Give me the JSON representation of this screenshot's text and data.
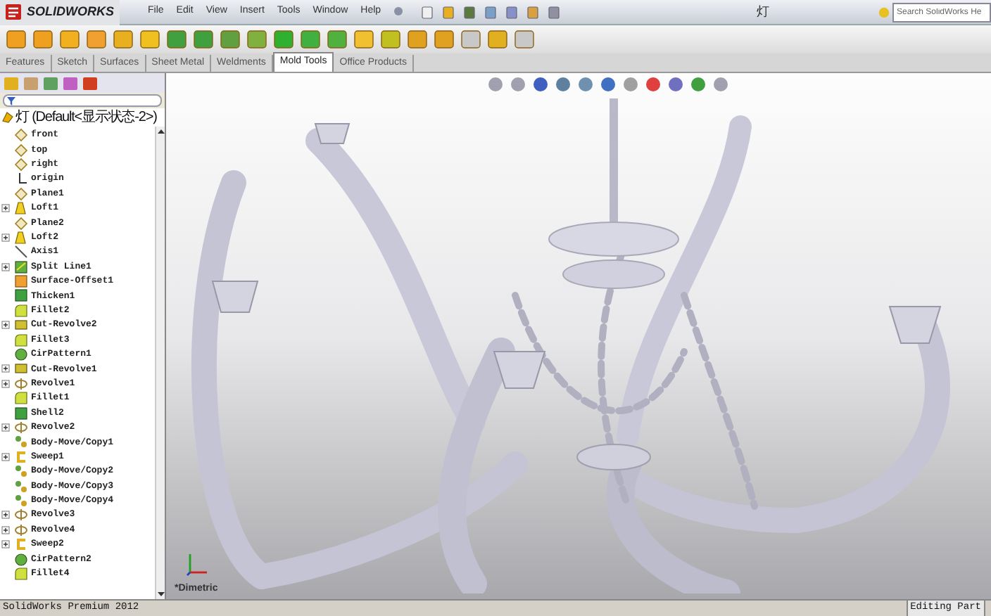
{
  "window": {
    "app_name": "SOLIDWORKS",
    "title": "灯"
  },
  "menu": [
    "File",
    "Edit",
    "View",
    "Insert",
    "Tools",
    "Window",
    "Help"
  ],
  "search": {
    "placeholder": "Search SolidWorks He"
  },
  "tabs": [
    {
      "label": "Features",
      "selected": false
    },
    {
      "label": "Sketch",
      "selected": false
    },
    {
      "label": "Surfaces",
      "selected": false
    },
    {
      "label": "Sheet Metal",
      "selected": false
    },
    {
      "label": "Weldments",
      "selected": false
    },
    {
      "label": "Mold Tools",
      "selected": true
    },
    {
      "label": "Office Products",
      "selected": false
    }
  ],
  "feature_tree": {
    "root": "灯 (Default<显示状态-2>)",
    "items": [
      {
        "label": "front",
        "kind": "plane",
        "expandable": false
      },
      {
        "label": "top",
        "kind": "plane",
        "expandable": false
      },
      {
        "label": "right",
        "kind": "plane",
        "expandable": false
      },
      {
        "label": "origin",
        "kind": "origin",
        "expandable": false
      },
      {
        "label": "Plane1",
        "kind": "plane",
        "expandable": false
      },
      {
        "label": "Loft1",
        "kind": "loft",
        "expandable": true
      },
      {
        "label": "Plane2",
        "kind": "plane",
        "expandable": false
      },
      {
        "label": "Loft2",
        "kind": "loft",
        "expandable": true
      },
      {
        "label": "Axis1",
        "kind": "axis",
        "expandable": false
      },
      {
        "label": "Split Line1",
        "kind": "split",
        "expandable": true
      },
      {
        "label": "Surface-Offset1",
        "kind": "offset",
        "expandable": false
      },
      {
        "label": "Thicken1",
        "kind": "thicken",
        "expandable": false
      },
      {
        "label": "Fillet2",
        "kind": "fillet",
        "expandable": false
      },
      {
        "label": "Cut-Revolve2",
        "kind": "cut",
        "expandable": true
      },
      {
        "label": "Fillet3",
        "kind": "fillet",
        "expandable": false
      },
      {
        "label": "CirPattern1",
        "kind": "pattern",
        "expandable": false
      },
      {
        "label": "Cut-Revolve1",
        "kind": "cut",
        "expandable": true
      },
      {
        "label": "Revolve1",
        "kind": "revolve",
        "expandable": true
      },
      {
        "label": "Fillet1",
        "kind": "fillet",
        "expandable": false
      },
      {
        "label": "Shell2",
        "kind": "thicken",
        "expandable": false
      },
      {
        "label": "Revolve2",
        "kind": "revolve",
        "expandable": true
      },
      {
        "label": "Body-Move/Copy1",
        "kind": "move",
        "expandable": false
      },
      {
        "label": "Sweep1",
        "kind": "sweep",
        "expandable": true
      },
      {
        "label": "Body-Move/Copy2",
        "kind": "move",
        "expandable": false
      },
      {
        "label": "Body-Move/Copy3",
        "kind": "move",
        "expandable": false
      },
      {
        "label": "Body-Move/Copy4",
        "kind": "move",
        "expandable": false
      },
      {
        "label": "Revolve3",
        "kind": "revolve",
        "expandable": true
      },
      {
        "label": "Revolve4",
        "kind": "revolve",
        "expandable": true
      },
      {
        "label": "Sweep2",
        "kind": "sweep",
        "expandable": true
      },
      {
        "label": "CirPattern2",
        "kind": "pattern",
        "expandable": false
      },
      {
        "label": "Fillet4",
        "kind": "fillet",
        "expandable": false
      }
    ]
  },
  "viewport": {
    "view_label": "*Dimetric"
  },
  "status_bar": {
    "product": "SolidWorks Premium 2012",
    "mode": "Editing Part"
  }
}
